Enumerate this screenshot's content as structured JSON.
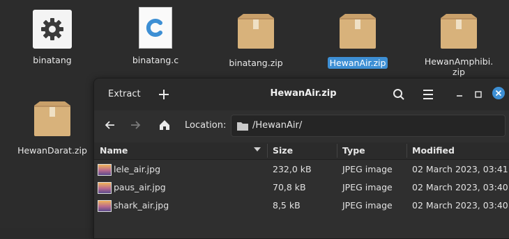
{
  "desktop": {
    "icons": [
      {
        "label": "binatang",
        "icon": "gear-icon"
      },
      {
        "label": "binatang.c",
        "icon": "c-file-icon"
      },
      {
        "label": "binatang.zip",
        "icon": "archive-box-icon"
      },
      {
        "label": "HewanAir.zip",
        "icon": "archive-box-icon",
        "selected": true
      },
      {
        "label": "HewanAmphibi.\nzip",
        "icon": "archive-box-icon"
      },
      {
        "label": "HewanDarat.zip",
        "icon": "archive-box-icon"
      }
    ]
  },
  "window": {
    "title": "HewanAir.zip",
    "extract_label": "Extract",
    "add_icon": "plus-icon",
    "search_icon": "search-icon",
    "menu_icon": "hamburger-menu-icon",
    "location_label": "Location:",
    "location_value": "/HewanAir/",
    "columns": {
      "name": "Name",
      "size": "Size",
      "type": "Type",
      "modified": "Modified"
    },
    "files": [
      {
        "name": "lele_air.jpg",
        "size": "232,0 kB",
        "type": "JPEG image",
        "modified": "02 March 2023, 03:41"
      },
      {
        "name": "paus_air.jpg",
        "size": "70,8 kB",
        "type": "JPEG image",
        "modified": "02 March 2023, 03:40"
      },
      {
        "name": "shark_air.jpg",
        "size": "8,5 kB",
        "type": "JPEG image",
        "modified": "02 March 2023, 03:40"
      }
    ]
  },
  "colors": {
    "accent": "#3d8fd4",
    "close_button": "#3d8fd4",
    "box": "#d8b27b"
  }
}
